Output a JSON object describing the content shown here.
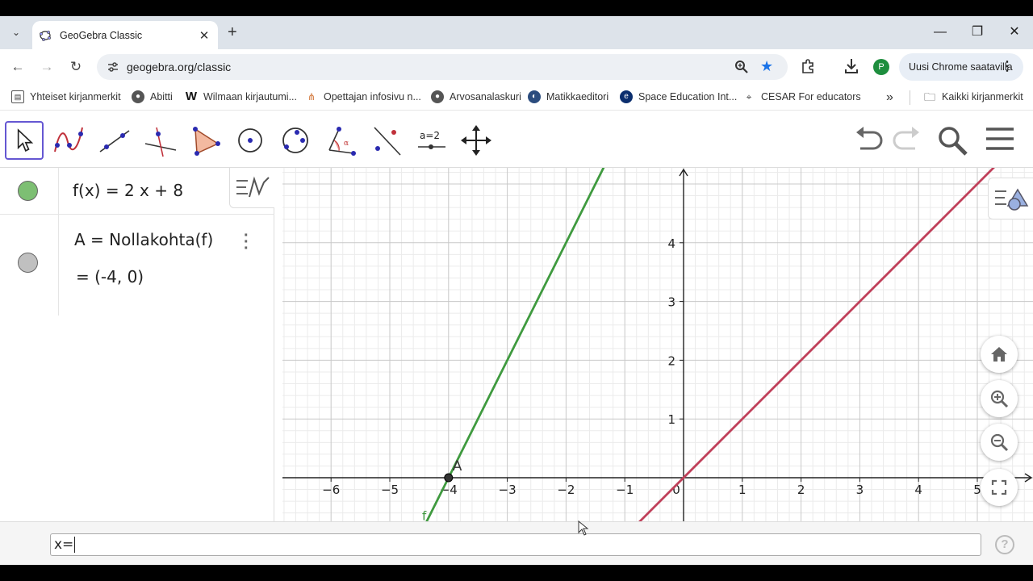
{
  "browser": {
    "tab_title": "GeoGebra Classic",
    "url": "geogebra.org/classic",
    "profile_initial": "P",
    "update_label": "Uusi Chrome saatavilla",
    "bookmarks": [
      {
        "label": "Yhteiset kirjanmerkit",
        "icon": "shared-bookmarks-icon"
      },
      {
        "label": "Abitti",
        "icon": "globe-icon"
      },
      {
        "label": "Wilmaan kirjautumi...",
        "icon": "wilma-icon"
      },
      {
        "label": "Opettajan infosivu n...",
        "icon": "info-page-icon"
      },
      {
        "label": "Arvosanalaskuri",
        "icon": "globe-icon"
      },
      {
        "label": "Matikkaeditori",
        "icon": "editor-icon"
      },
      {
        "label": "Space Education Int...",
        "icon": "space-ed-icon"
      },
      {
        "label": "CESAR For educators",
        "icon": "telescope-icon"
      }
    ],
    "all_bookmarks_label": "Kaikki kirjanmerkit"
  },
  "algebra": {
    "f_def": "f(x)  =  2 x + 8",
    "A_def": "A  =  Nollakohta(f)",
    "A_value": "=   (-4, 0)",
    "f_color": "#7dbf73",
    "A_color": "#c0c0c0"
  },
  "graph": {
    "x_ticks": [
      "−6",
      "−5",
      "−4",
      "−3",
      "−2",
      "−1",
      "0",
      "1",
      "2",
      "3",
      "4",
      "5"
    ],
    "y_ticks": [
      "1",
      "2",
      "3",
      "4"
    ],
    "point_label": "A",
    "function_label": "f",
    "line_f_color": "#3f9a3f",
    "line_red_color": "#c0405a"
  },
  "input": {
    "value": "x="
  }
}
